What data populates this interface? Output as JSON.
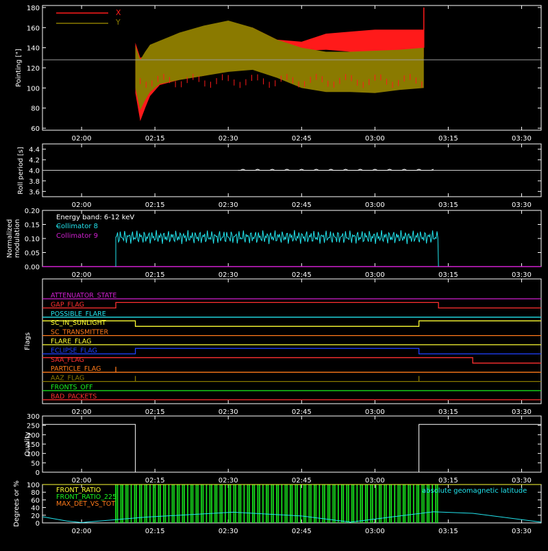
{
  "colors": {
    "background": "#000000",
    "axes": "#ffffff",
    "x_pointing": "#ff1a1a",
    "y_pointing": "#8a7a00",
    "cyan": "#22e5ee",
    "magenta": "#d020d0",
    "green": "#19f21f",
    "orange": "#ff7a1a",
    "white": "#ffffff"
  },
  "time_axis": {
    "range": [
      "01:52",
      "03:34"
    ],
    "ticks": [
      "02:00",
      "02:15",
      "02:30",
      "02:45",
      "03:00",
      "03:15",
      "03:30"
    ]
  },
  "chart_data": [
    {
      "id": "pointing",
      "type": "line",
      "ylabel": "Pointing [\"]",
      "ylim": [
        58,
        182
      ],
      "yticks": [
        "60",
        "80",
        "100",
        "120",
        "140",
        "160",
        "180"
      ],
      "reference_line": 128,
      "legend": [
        "X",
        "Y"
      ],
      "series": [
        {
          "name": "X",
          "kind": "band",
          "x": [
            "02:11",
            "02:12",
            "02:13",
            "02:14",
            "02:16",
            "02:20",
            "02:25",
            "02:30",
            "02:35",
            "02:40",
            "02:45",
            "02:50",
            "02:55",
            "03:00",
            "03:05",
            "03:10"
          ],
          "upper": [
            145,
            130,
            132,
            138,
            145,
            152,
            160,
            164,
            160,
            148,
            146,
            154,
            156,
            158,
            158,
            158
          ],
          "lower": [
            95,
            67,
            80,
            92,
            103,
            108,
            112,
            117,
            120,
            128,
            137,
            138,
            136,
            132,
            131,
            131
          ]
        },
        {
          "name": "Y",
          "kind": "band",
          "x": [
            "02:11",
            "02:12",
            "02:13",
            "02:14",
            "02:16",
            "02:20",
            "02:25",
            "02:30",
            "02:35",
            "02:40",
            "02:45",
            "02:50",
            "02:55",
            "03:00",
            "03:05",
            "03:10"
          ],
          "upper": [
            142,
            128,
            136,
            143,
            147,
            155,
            162,
            167,
            160,
            148,
            140,
            136,
            136,
            137,
            138,
            140
          ],
          "lower": [
            100,
            78,
            88,
            96,
            104,
            108,
            112,
            116,
            118,
            110,
            100,
            96,
            96,
            95,
            98,
            100
          ]
        }
      ]
    },
    {
      "id": "roll-period",
      "type": "line",
      "ylabel": "Roll period [s]",
      "ylim": [
        3.5,
        4.5
      ],
      "yticks": [
        "3.6",
        "3.8",
        "4.0",
        "4.2",
        "4.4"
      ],
      "series": [
        {
          "name": "roll-period",
          "x": [
            "02:32",
            "03:12"
          ],
          "y": [
            4.0,
            4.0
          ]
        }
      ]
    },
    {
      "id": "modulation",
      "type": "line",
      "ylabel": [
        "Normalized",
        "modulation"
      ],
      "ylim": [
        0,
        0.2
      ],
      "yticks": [
        "0.00",
        "0.05",
        "0.10",
        "0.15",
        "0.20"
      ],
      "annotation": "Energy band: 6-12 keV",
      "legend": [
        "Collimator 8",
        "Collimator 9"
      ],
      "series": [
        {
          "name": "Collimator 8",
          "x_start": "02:07",
          "x_end": "03:13",
          "mean": 0.105,
          "spread": 0.025
        },
        {
          "name": "Collimator 9",
          "x_start": "01:52",
          "x_end": "03:34",
          "mean": 0.0,
          "spread": 0.0
        }
      ]
    },
    {
      "id": "flags",
      "type": "line",
      "ylabel": "Flags",
      "series": [
        {
          "name": "ATTENUATOR_STATE",
          "color": "#d020d0",
          "steps": []
        },
        {
          "name": "SAA_FLAG_TOP",
          "label": "GAP_FLAG",
          "color": "#ff3030",
          "steps": [
            [
              "01:52",
              0
            ],
            [
              "02:07",
              0
            ],
            [
              "02:07",
              -1
            ],
            [
              "03:13",
              -1
            ],
            [
              "03:13",
              0
            ],
            [
              "03:34",
              0
            ]
          ]
        },
        {
          "name": "POSSIBLE_FLARE",
          "color": "#22e5ee",
          "steps": []
        },
        {
          "name": "SC_IN_SUNLIGHT",
          "color": "#ffff33",
          "steps": [
            [
              "01:52",
              -1
            ],
            [
              "02:11",
              -1
            ],
            [
              "02:11",
              0
            ],
            [
              "03:09",
              0
            ],
            [
              "03:09",
              -1
            ],
            [
              "03:34",
              -1
            ]
          ]
        },
        {
          "name": "SC_TRANSMITTER",
          "color": "#ff7a1a",
          "steps": []
        },
        {
          "name": "FLARE_FLAG",
          "color": "#ffff33",
          "steps": []
        },
        {
          "name": "ECLIPSE_FLAG",
          "color": "#2040ff",
          "steps": [
            [
              "01:52",
              0
            ],
            [
              "02:11",
              0
            ],
            [
              "02:11",
              -1
            ],
            [
              "03:09",
              -1
            ],
            [
              "03:09",
              0
            ],
            [
              "03:34",
              0
            ]
          ]
        },
        {
          "name": "SAA_FLAG",
          "color": "#ff3030",
          "steps": [
            [
              "01:52",
              -1
            ],
            [
              "03:20",
              -1
            ],
            [
              "03:20",
              0
            ],
            [
              "03:34",
              0
            ]
          ]
        },
        {
          "name": "PARTICLE_FLAG",
          "color": "#ff7a1a",
          "steps": [],
          "spikes": [
            "02:07"
          ]
        },
        {
          "name": "AAZ_FLAG",
          "color": "#8a7a00",
          "steps": [],
          "spikes": [
            "02:11",
            "03:09"
          ]
        },
        {
          "name": "FRONTS_OFF",
          "color": "#19f21f",
          "steps": []
        },
        {
          "name": "BAD_PACKETS",
          "color": "#ff3030",
          "steps": []
        }
      ]
    },
    {
      "id": "quality",
      "type": "line",
      "ylabel": "Quality",
      "ylim": [
        0,
        300
      ],
      "yticks": [
        "0",
        "50",
        "100",
        "150",
        "200",
        "250",
        "300"
      ],
      "series": [
        {
          "name": "quality",
          "x": [
            "01:52",
            "02:11",
            "02:11",
            "03:09",
            "03:09",
            "03:34"
          ],
          "y": [
            255,
            255,
            0,
            0,
            255,
            255
          ]
        }
      ]
    },
    {
      "id": "front-ratio",
      "type": "line",
      "ylabel": "Degrees or %",
      "ylim": [
        0,
        100
      ],
      "yticks": [
        "0",
        "20",
        "40",
        "60",
        "80",
        "100"
      ],
      "legend": [
        "FRONT_RATIO",
        "FRONT_RATIO_225",
        "MAX_DET_VS_TOT"
      ],
      "legend_right": "absolute geomagnetic latitude",
      "series": [
        {
          "name": "FRONT_RATIO_225",
          "x_start": "02:07",
          "x_end": "03:13",
          "fill": 100
        },
        {
          "name": "MAX_DET_VS_TOT",
          "x": [
            "01:52",
            "02:07",
            "03:13",
            "03:34"
          ],
          "y": [
            100,
            100,
            100,
            100
          ]
        },
        {
          "name": "absolute geomagnetic latitude",
          "x": [
            "01:52",
            "01:57",
            "02:00",
            "02:13",
            "02:31",
            "02:45",
            "02:55",
            "03:05",
            "03:12",
            "03:20",
            "03:34"
          ],
          "y": [
            16,
            5,
            1,
            15,
            28,
            18,
            2,
            18,
            29,
            25,
            2
          ]
        }
      ]
    }
  ]
}
